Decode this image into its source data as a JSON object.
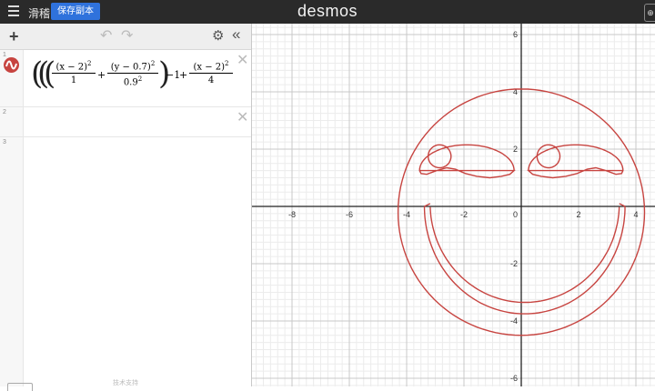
{
  "topbar": {
    "title": "滑稽",
    "save_label": "保存副本",
    "logo": "desmos",
    "corner_label": "⊕"
  },
  "toolbar": {
    "add_icon": "plus-icon",
    "undo_icon": "undo-icon",
    "redo_icon": "redo-icon",
    "settings_icon": "gear-icon",
    "collapse_icon": "double-chevron-left-icon"
  },
  "expressions": [
    {
      "number": "1",
      "color": "#c74440",
      "terms": {
        "f1_num": "(x − 2)",
        "f1_exp": "2",
        "f1_den": "1",
        "plus1": "+",
        "f2_num": "(y − 0.7)",
        "f2_exp": "2",
        "f2_den": "0.9",
        "f2_den_exp": "2",
        "minus_one": "−1",
        "plus2": "+",
        "f3_num": "(x − 2)",
        "f3_exp": "2",
        "f3_den": "4"
      }
    },
    {
      "number": "2"
    },
    {
      "number": "3"
    }
  ],
  "footer": {
    "text": "技术支持"
  },
  "graph": {
    "x_ticks": [
      "-8",
      "-6",
      "-4",
      "-2",
      "0",
      "2",
      "4"
    ],
    "y_ticks": [
      "6",
      "4",
      "2",
      "-2",
      "-4",
      "-6"
    ],
    "curve_color": "#c74440"
  }
}
